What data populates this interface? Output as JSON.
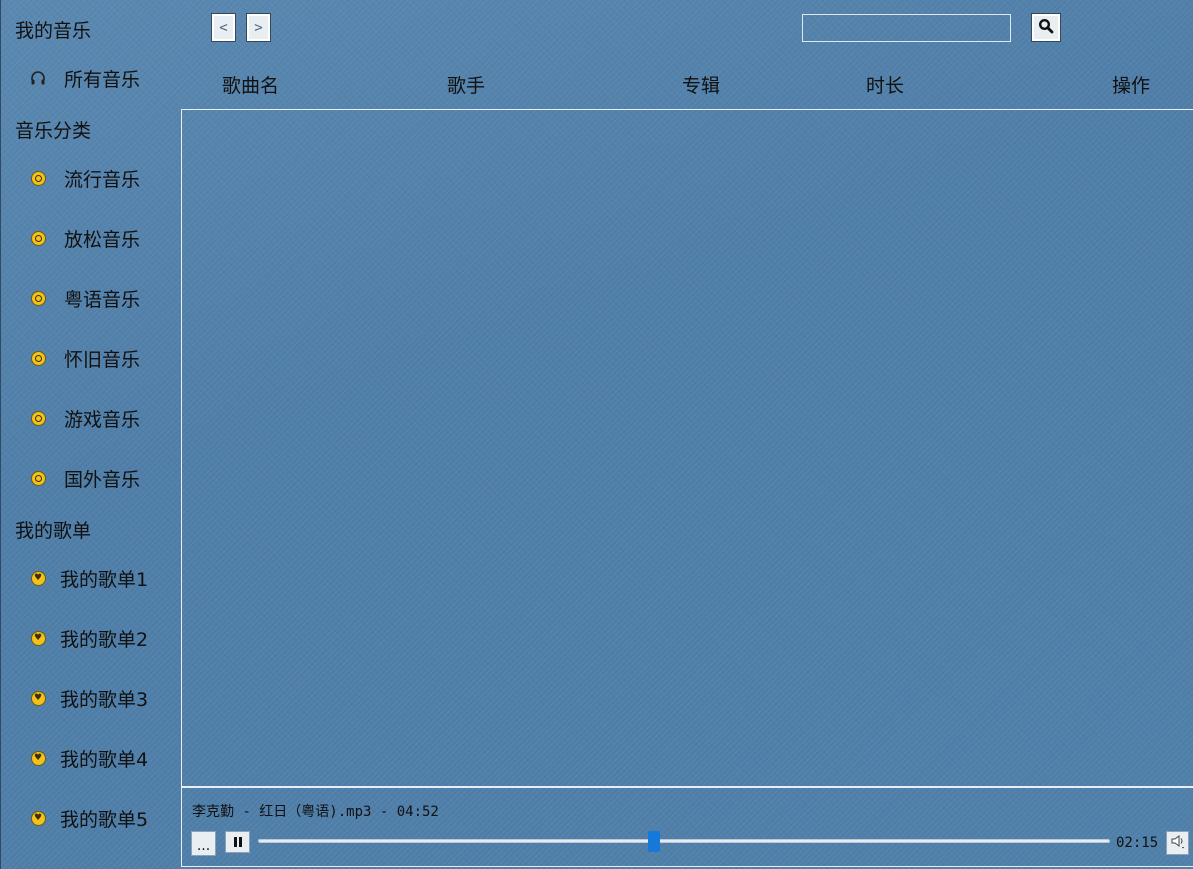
{
  "sidebar": {
    "my_music_title": "我的音乐",
    "all_music": {
      "label": "所有音乐",
      "icon": "headphones-icon"
    },
    "category_title": "音乐分类",
    "categories": [
      {
        "label": "流行音乐",
        "icon": "disc-icon"
      },
      {
        "label": "放松音乐",
        "icon": "disc-icon"
      },
      {
        "label": "粤语音乐",
        "icon": "disc-icon"
      },
      {
        "label": "怀旧音乐",
        "icon": "disc-icon"
      },
      {
        "label": "游戏音乐",
        "icon": "disc-icon"
      },
      {
        "label": "国外音乐",
        "icon": "disc-icon"
      }
    ],
    "playlist_title": "我的歌单",
    "playlists": [
      {
        "label": "我的歌单1",
        "icon": "heart-disc-icon"
      },
      {
        "label": "我的歌单2",
        "icon": "heart-disc-icon"
      },
      {
        "label": "我的歌单3",
        "icon": "heart-disc-icon"
      },
      {
        "label": "我的歌单4",
        "icon": "heart-disc-icon"
      },
      {
        "label": "我的歌单5",
        "icon": "heart-disc-icon"
      }
    ]
  },
  "toolbar": {
    "back_glyph": "<",
    "forward_glyph": ">",
    "search_value": "",
    "search_icon": "search-icon"
  },
  "table": {
    "columns": [
      "歌曲名",
      "歌手",
      "专辑",
      "时长",
      "操作"
    ],
    "rows": []
  },
  "player": {
    "now_playing": "李克勤 - 红日（粤语).mp3 - 04:52",
    "more_label": "...",
    "elapsed": "02:15",
    "progress_fraction": 0.465,
    "accent_color": "#1479d8",
    "disc_color": "#f3c21a"
  }
}
